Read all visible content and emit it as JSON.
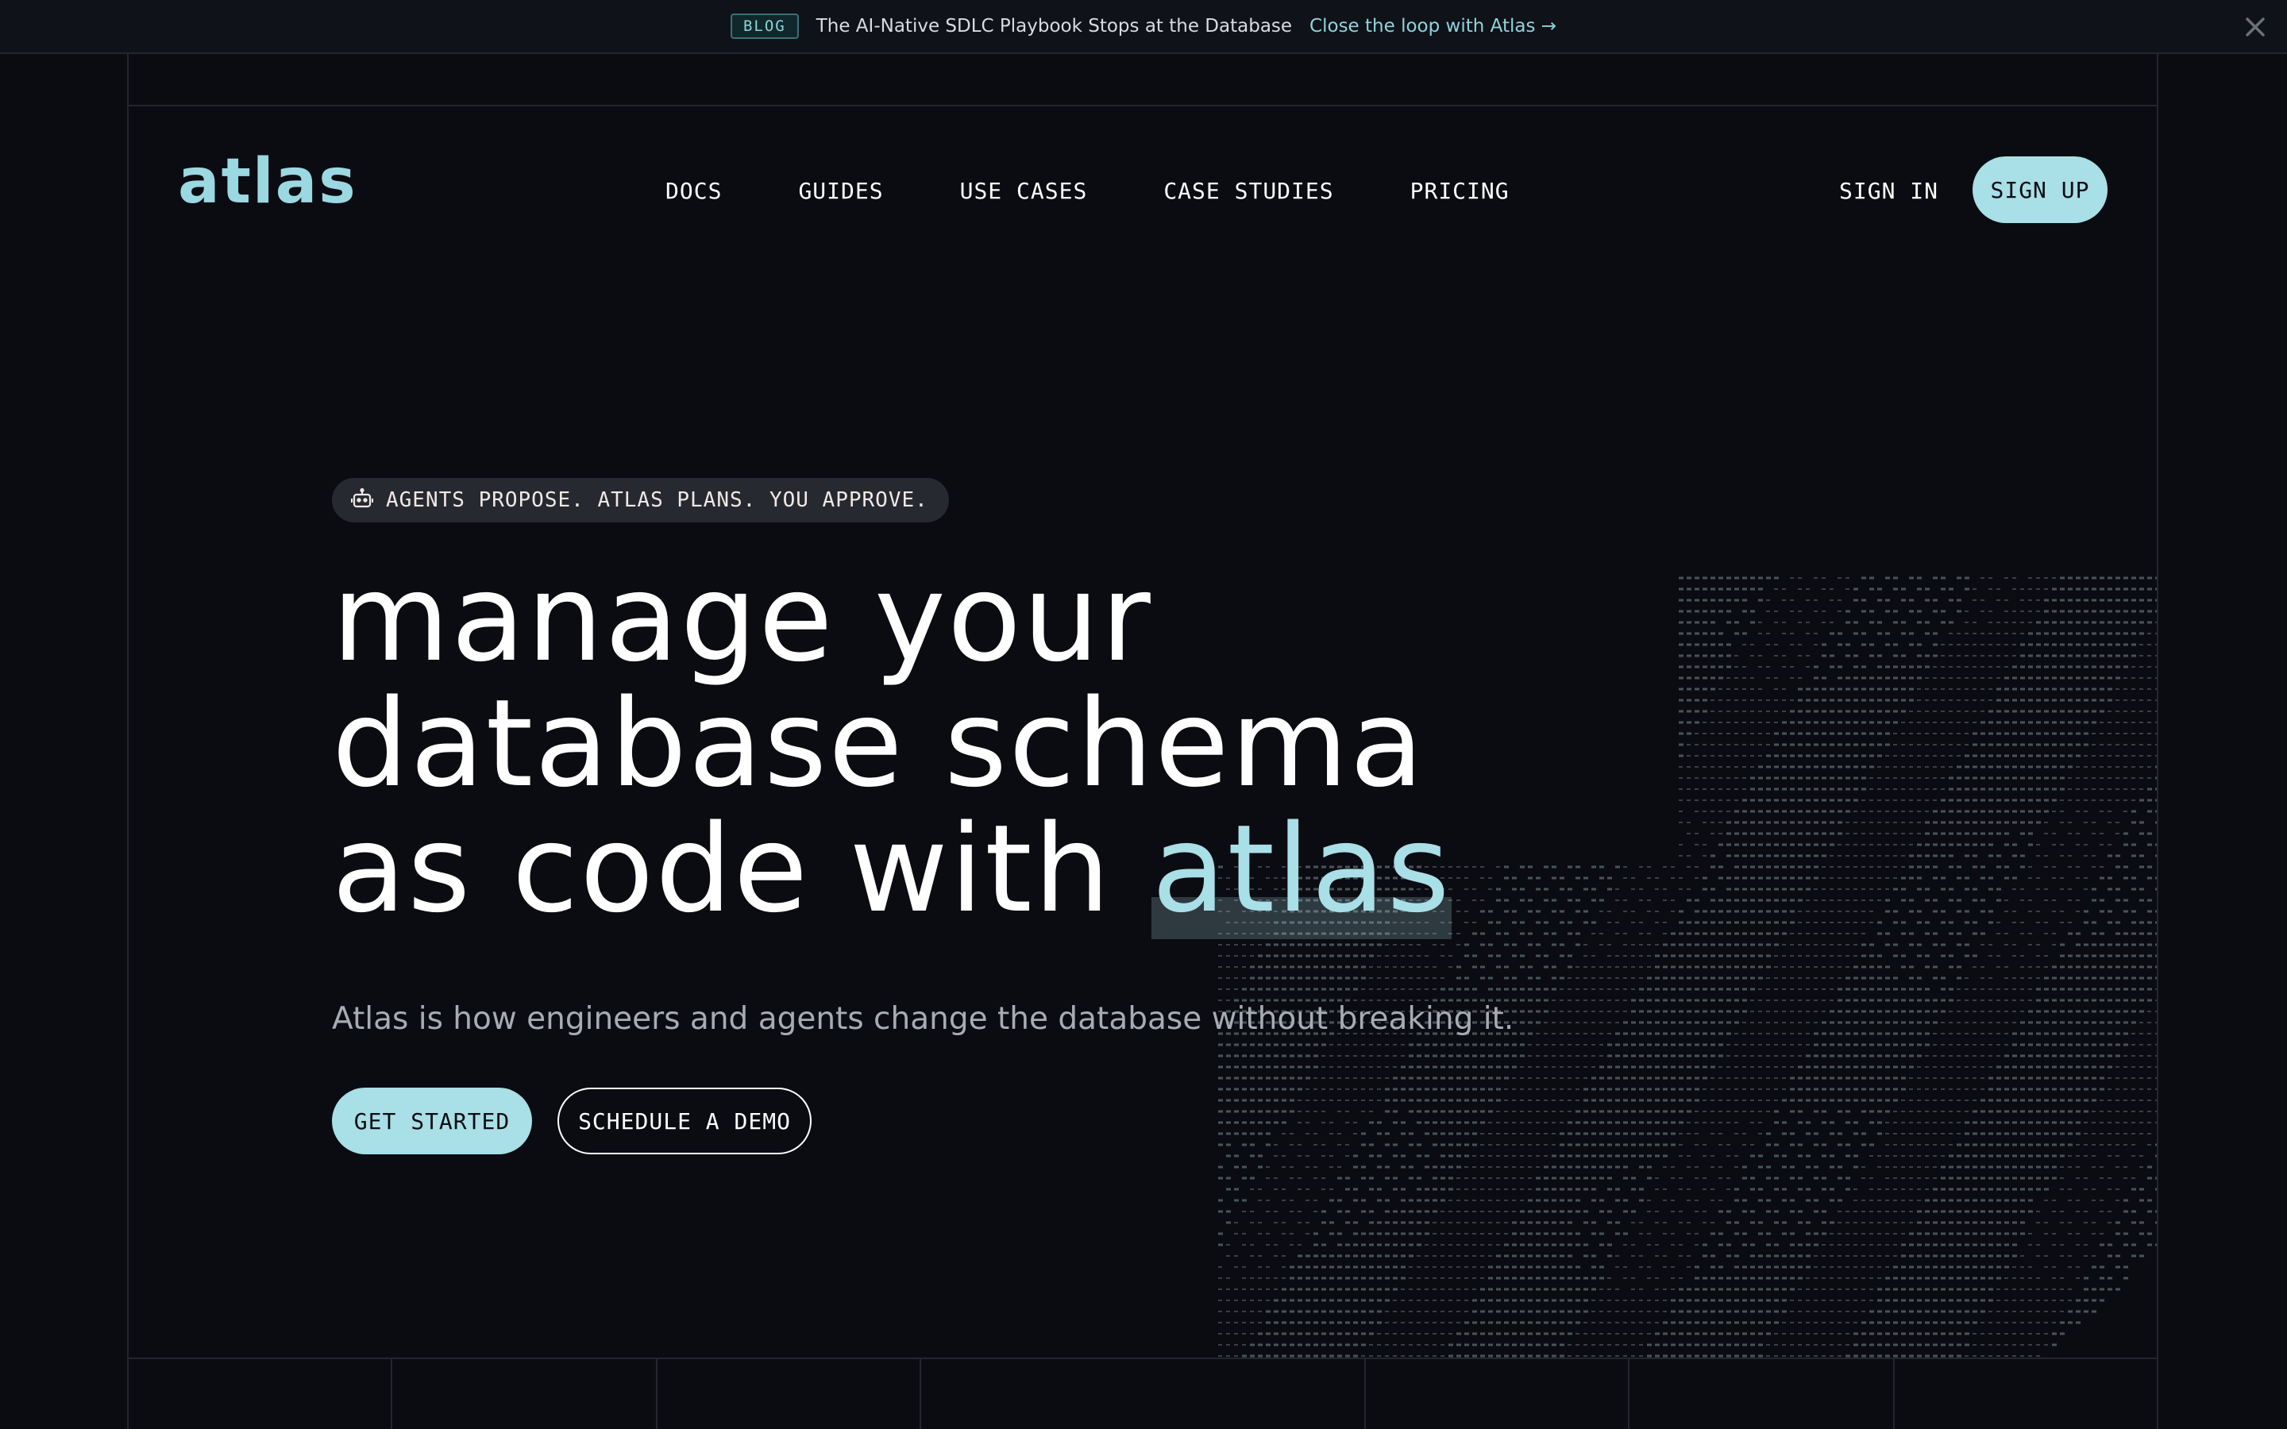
{
  "announcement": {
    "badge": "BLOG",
    "text": "The AI-Native SDLC Playbook Stops at the Database",
    "link_text": "Close the loop with Atlas →",
    "close_icon": "close-icon"
  },
  "nav": {
    "logo": "atlas",
    "items": [
      "DOCS",
      "GUIDES",
      "USE CASES",
      "CASE STUDIES",
      "PRICING"
    ],
    "sign_in": "SIGN IN",
    "sign_up": "SIGN UP"
  },
  "hero": {
    "pill_icon": "robot-icon",
    "pill_text": "AGENTS PROPOSE. ATLAS PLANS. YOU APPROVE.",
    "headline_line1": "manage your",
    "headline_line2": "database schema",
    "headline_line3_prefix": "as code with ",
    "headline_accent": "atlas",
    "subtitle": "Atlas is how engineers and agents change the database without breaking it.",
    "cta_primary": "GET STARTED",
    "cta_secondary": "SCHEDULE A DEMO"
  },
  "colors": {
    "background": "#0b0c12",
    "accent": "#a9dfe6",
    "text": "#ffffff",
    "muted": "#a7abb2"
  }
}
